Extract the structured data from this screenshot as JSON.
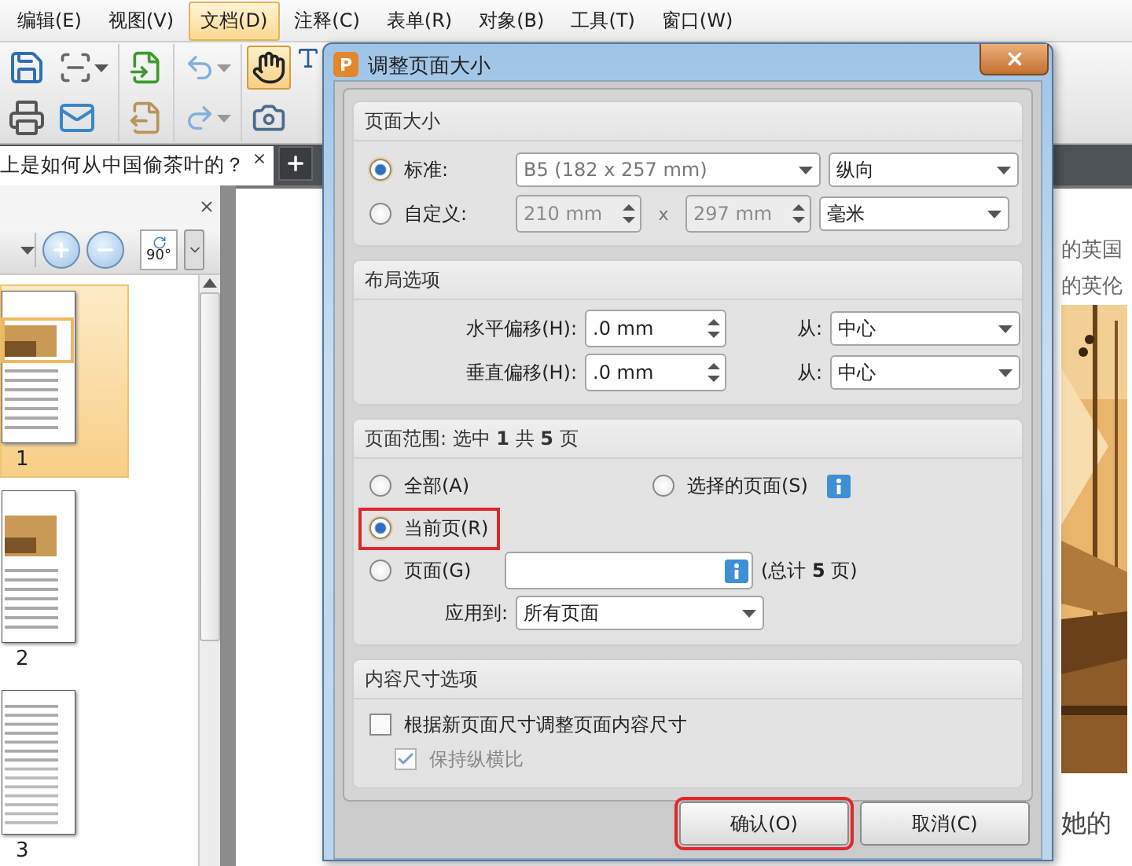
{
  "menu": [
    {
      "label": "编辑(E)",
      "selected": false
    },
    {
      "label": "视图(V)",
      "selected": false
    },
    {
      "label": "文档(D)",
      "selected": true
    },
    {
      "label": "注释(C)",
      "selected": false
    },
    {
      "label": "表单(R)",
      "selected": false
    },
    {
      "label": "对象(B)",
      "selected": false
    },
    {
      "label": "工具(T)",
      "selected": false
    },
    {
      "label": "窗口(W)",
      "selected": false
    }
  ],
  "toolbar": {
    "hand_tool": {
      "selected": true
    }
  },
  "document_tab": {
    "title": "上是如何从中国偷茶叶的？"
  },
  "pages_panel": {
    "rotate_label": "90°",
    "thumbnails": [
      {
        "page": "1",
        "selected": true
      },
      {
        "page": "2",
        "selected": false
      },
      {
        "page": "3",
        "selected": false
      }
    ]
  },
  "document": {
    "lines": [
      "的英国",
      "的英伦"
    ],
    "footer_text": "她的"
  },
  "dialog": {
    "app_icon": "P",
    "title": "调整页面大小",
    "page_size": {
      "heading": "页面大小",
      "options": [
        {
          "label": "标准:",
          "selected": true
        },
        {
          "label": "自定义:",
          "selected": false
        }
      ],
      "standard_size": "B5 (182 x 257 mm)",
      "orientation": "纵向",
      "custom_width": {
        "value": "210 mm",
        "disabled": true
      },
      "times": "x",
      "custom_height": {
        "value": "297 mm",
        "disabled": true
      },
      "unit": "毫米"
    },
    "layout": {
      "heading": "布局选项",
      "rows": [
        {
          "label": "水平偏移(H):",
          "value": ".0 mm",
          "from_label": "从:",
          "from": "中心"
        },
        {
          "label": "垂直偏移(H):",
          "value": ".0 mm",
          "from_label": "从:",
          "from": "中心"
        }
      ]
    },
    "page_range": {
      "heading": "页面范围: 选中 **1** 共 **5** 页",
      "options": [
        {
          "kind": "plain",
          "label": "全部(A)",
          "selected": false,
          "highlighted": false
        },
        {
          "kind": "info",
          "label": "选择的页面(S)",
          "selected": false,
          "highlighted": false
        },
        {
          "kind": "plain",
          "label": "当前页(R)",
          "selected": true,
          "highlighted": true
        },
        {
          "kind": "field",
          "label": "页面(G)",
          "selected": false,
          "highlighted": false
        }
      ],
      "pages_total": "(总计 **5** 页)",
      "apply_label": "应用到:",
      "apply_to": "所有页面"
    },
    "content_size": {
      "heading": "内容尺寸选项",
      "checkboxes": [
        {
          "label": "根据新页面尺寸调整页面内容尺寸",
          "checked": false,
          "disabled": false
        },
        {
          "label": "保持纵横比",
          "checked": true,
          "disabled": true
        }
      ]
    },
    "buttons": [
      {
        "label": "确认(O)",
        "highlighted": true
      },
      {
        "label": "取消(C)",
        "highlighted": false
      }
    ]
  }
}
